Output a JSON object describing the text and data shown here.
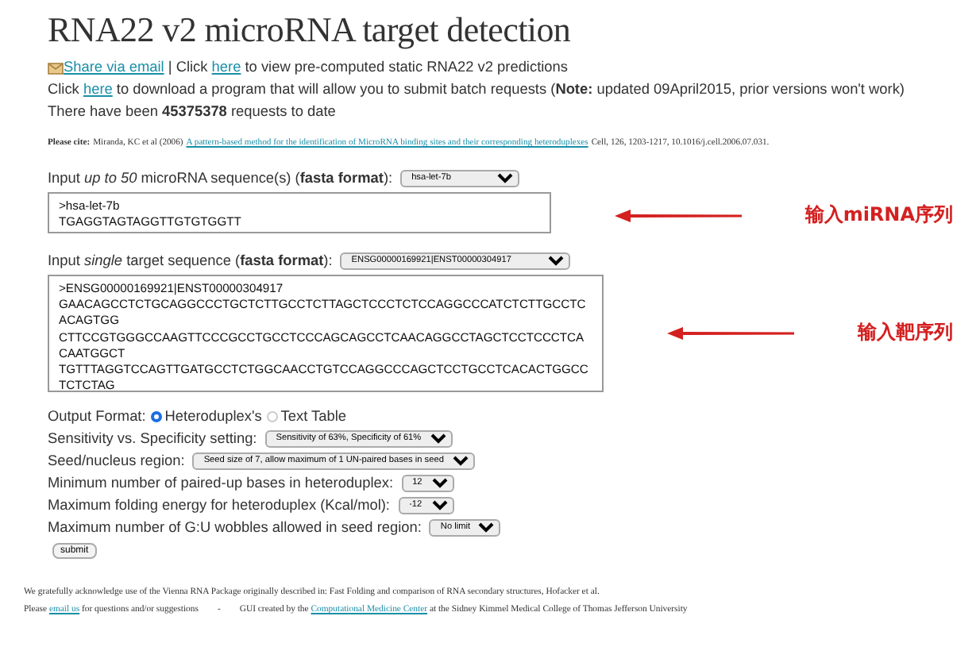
{
  "title": "RNA22 v2 microRNA target detection",
  "intro": [
    {
      "kind": "share",
      "link": "Share via email",
      "text": "| Click ",
      "link2": "here",
      "text2": " to view pre-computed static RNA22 v2 predictions"
    },
    {
      "kind": "download",
      "text": "Click ",
      "link": "here",
      "text2": " to download a program that will allow you to submit batch requests (**Note:** updated 09April2015, prior versions won't work)"
    },
    {
      "kind": "count",
      "text": "There have been **45375378** requests to date"
    }
  ],
  "citation": {
    "label": "Please cite:",
    "text": "Miranda, KC et al (2006)",
    "link": "A pattern-based method for the identification of MicroRNA binding sites and their corresponding heteroduplexes",
    "tail": "Cell, 126, 1203-1217, 10.1016/j.cell.2006.07.031."
  },
  "mirna_input": {
    "label": "Input *up to 50* microRNA sequence(s) (**fasta format**):",
    "select": "hsa-let-7b",
    "value": ">hsa-let-7b\nTGAGGTAGTAGGTTGTGTGGTT",
    "annotation": "输入miRNA序列"
  },
  "target_input": {
    "label": "Input *single* target sequence (**fasta format**):",
    "select": "ENSG00000169921|ENST00000304917",
    "value": ">ENSG00000169921|ENST00000304917\nGAACAGCCTCTGCAGGCCCTGCTCTTGCCTCTTAGCTCCCTCTCCAGGCCCATCTCTTGCCTCACAGTGG\nCTTCCGTGGGCCAAGTTCCCGCCTGCCTCCCAGCAGCCTCAACAGGCCTAGCTCCTCCCTCACAATGGCT\nTGTTTAGGTCCAGTTGATGCCTCTGGCAACCTGTCCAGGCCCAGCTCCTGCCTCACACTGGCCTCTCTAG",
    "annotation": "输入靶序列"
  },
  "output_format": {
    "label": "Output Format:",
    "options": [
      {
        "label": "Heteroduplex's",
        "selected": true
      },
      {
        "label": "Text Table",
        "selected": false
      }
    ]
  },
  "settings": [
    {
      "label": "Sensitivity vs. Specificity setting:",
      "value": "Sensitivity of 63%, Specificity of 61%"
    },
    {
      "label": "Seed/nucleus region:",
      "value": "Seed size of 7, allow maximum of 1 UN-paired bases in seed"
    },
    {
      "label": "Minimum number of paired-up bases in heteroduplex:",
      "value": "12"
    },
    {
      "label": "Maximum folding energy for heteroduplex (Kcal/mol):",
      "value": "-12"
    },
    {
      "label": "Maximum number of G:U wobbles allowed in seed region:",
      "value": "No limit"
    }
  ],
  "submit": "submit",
  "footer": {
    "ack": "We gratefully acknowledge use of the Vienna RNA Package originally described in: Fast Folding and comparison of RNA secondary structures, Hofacker et al.",
    "contact_pre": "Please ",
    "contact_link": "email us",
    "contact_post": " for questions and/or suggestions",
    "sep": "-",
    "credit_pre": "GUI created by the ",
    "credit_link": "Computational Medicine Center",
    "credit_post": " at the Sidney Kimmel Medical College of Thomas Jefferson University"
  }
}
